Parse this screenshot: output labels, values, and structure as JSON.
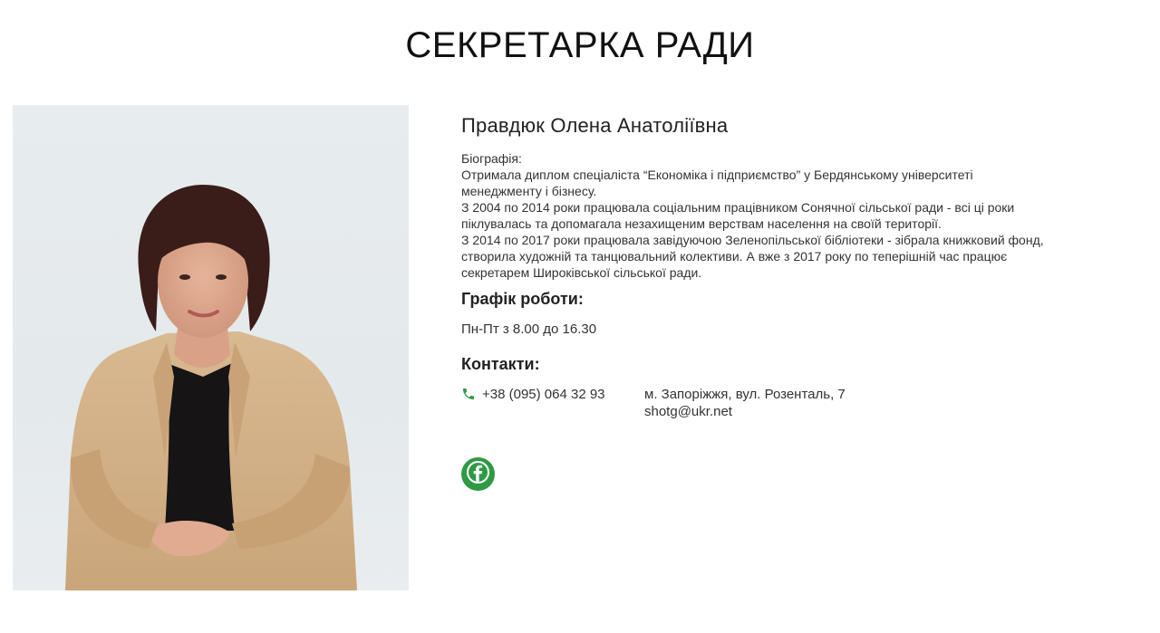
{
  "page": {
    "title": "СЕКРЕТАРКА РАДИ"
  },
  "person": {
    "name": "Правдюк Олена Анатоліївна",
    "bio_heading": "Біографія:",
    "bio_lines": [
      "Отримала диплом спеціаліста “Економіка і підприємство” у Бердянському університеті",
      "менеджменту і бізнесу.",
      "З 2004 по 2014 роки працювала соціальним працівником Сонячної сільської ради - всі ці роки",
      "піклувалась та допомагала незахищеним верствам населення на своїй території.",
      "З 2014 по 2017 роки працювала завідуючою Зеленопільської бібліотеки - зібрала книжковий фонд,",
      "створила художній та танцювальний колективи. А вже з 2017 року по теперішній час працює",
      "секретарем Широківської сільської ради."
    ]
  },
  "schedule": {
    "title": "Графік роботи:",
    "value": "Пн-Пт з 8.00 до 16.30"
  },
  "contacts": {
    "title": "Контакти:",
    "phone": "+38 (095) 064 32 93",
    "address": "м. Запоріжжя, вул. Розенталь, 7",
    "email": "shotg@ukr.net"
  },
  "social": {
    "facebook_icon": "facebook-icon"
  },
  "colors": {
    "accent": "#2f9a45",
    "text": "#333333",
    "title": "#111111"
  }
}
